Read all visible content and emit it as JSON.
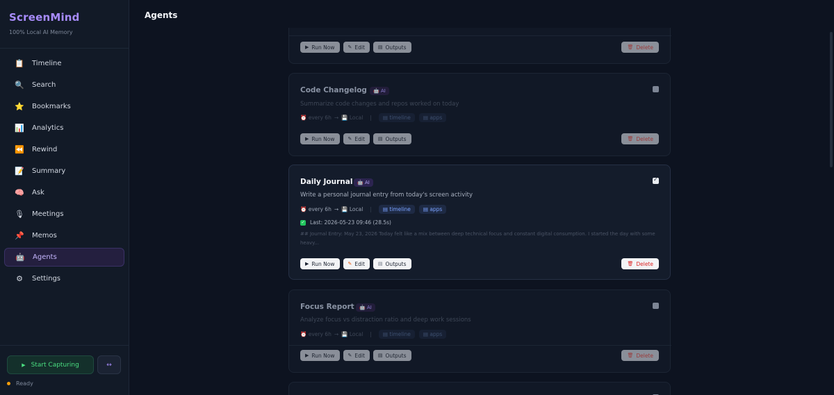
{
  "app": {
    "title": "ScreenMind",
    "subtitle": "100% Local AI Memory"
  },
  "sidebar": {
    "items": [
      {
        "label": "Timeline",
        "icon": "📋",
        "icon_name": "clipboard-icon"
      },
      {
        "label": "Search",
        "icon": "🔍",
        "icon_name": "search-icon"
      },
      {
        "label": "Bookmarks",
        "icon": "⭐",
        "icon_name": "star-icon"
      },
      {
        "label": "Analytics",
        "icon": "📊",
        "icon_name": "chart-icon"
      },
      {
        "label": "Rewind",
        "icon": "⏪",
        "icon_name": "rewind-icon"
      },
      {
        "label": "Summary",
        "icon": "📝",
        "icon_name": "memo-icon"
      },
      {
        "label": "Ask",
        "icon": "🧠",
        "icon_name": "brain-icon"
      },
      {
        "label": "Meetings",
        "icon": "🎙",
        "icon_name": "microphone-icon"
      },
      {
        "label": "Memos",
        "icon": "📌",
        "icon_name": "pin-icon"
      },
      {
        "label": "Agents",
        "icon": "🤖",
        "icon_name": "robot-icon"
      },
      {
        "label": "Settings",
        "icon": "⚙",
        "icon_name": "gear-icon"
      }
    ],
    "active": "Agents",
    "start_label": "Start Capturing",
    "start_icon": "▶",
    "link_icon": "↔",
    "status": "Ready",
    "status_color": "#f59e0b"
  },
  "page": {
    "title": "Agents"
  },
  "buttons": {
    "run": "Run Now",
    "edit": "Edit",
    "outputs": "Outputs",
    "delete": "Delete"
  },
  "agents": [
    {
      "name": "Code Changelog",
      "badge": "AI",
      "description": "Summarize code changes and repos worked on today",
      "schedule": "every 6h",
      "arrow": "→",
      "target": "Local",
      "tags": [
        "timeline",
        "apps"
      ],
      "enabled": false
    },
    {
      "name": "Daily Journal",
      "badge": "AI",
      "description": "Write a personal journal entry from today's screen activity",
      "schedule": "every 6h",
      "arrow": "→",
      "target": "Local",
      "tags": [
        "timeline",
        "apps"
      ],
      "enabled": true,
      "last_run": "Last: 2026-05-23 09:46 (28.5s)",
      "preview": "## Journal Entry: May 23, 2026 Today felt like a mix between deep technical focus and constant digital consumption. I started the day with some heavy..."
    },
    {
      "name": "Focus Report",
      "badge": "AI",
      "description": "Analyze focus vs distraction ratio and deep work sessions",
      "schedule": "every 6h",
      "arrow": "→",
      "target": "Local",
      "tags": [
        "timeline",
        "apps"
      ],
      "enabled": false
    }
  ],
  "colors": {
    "accent": "#a78bfa",
    "active_bg": "#241f3f",
    "success": "#22c55e",
    "danger": "#dc2626"
  }
}
